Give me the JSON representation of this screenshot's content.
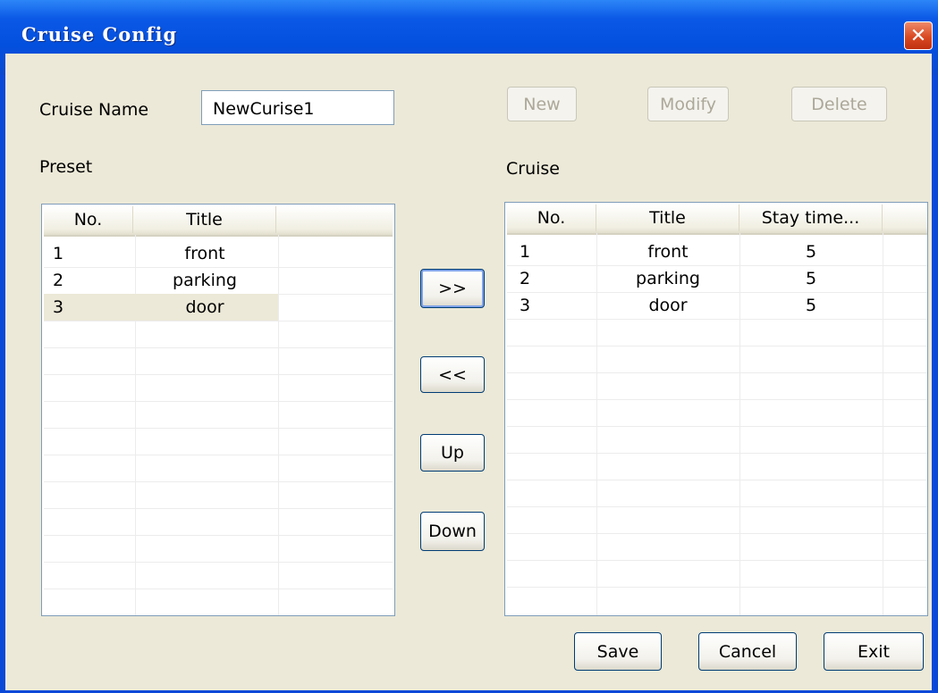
{
  "window": {
    "title": "Cruise Config",
    "close_glyph": "✕"
  },
  "form": {
    "cruise_name_label": "Cruise Name",
    "cruise_name_value": "NewCurise1",
    "new_label": "New",
    "modify_label": "Modify",
    "delete_label": "Delete"
  },
  "preset": {
    "label": "Preset",
    "columns": [
      "No.",
      "Title"
    ],
    "rows": [
      {
        "no": "1",
        "title": "front"
      },
      {
        "no": "2",
        "title": "parking"
      },
      {
        "no": "3",
        "title": "door"
      }
    ],
    "selected_row": 3
  },
  "cruise": {
    "label": "Cruise",
    "columns": [
      "No.",
      "Title",
      "Stay time..."
    ],
    "rows": [
      {
        "no": "1",
        "title": "front",
        "stay": "5"
      },
      {
        "no": "2",
        "title": "parking",
        "stay": "5"
      },
      {
        "no": "3",
        "title": "door",
        "stay": "5"
      }
    ]
  },
  "middle_buttons": {
    "add": ">>",
    "remove": "<<",
    "up": "Up",
    "down": "Down"
  },
  "footer": {
    "save": "Save",
    "cancel": "Cancel",
    "exit": "Exit"
  },
  "colors": {
    "titlebar": "#0450de",
    "client": "#ece9d8",
    "selection": "#ece9d8",
    "close_button": "#d94a22"
  }
}
